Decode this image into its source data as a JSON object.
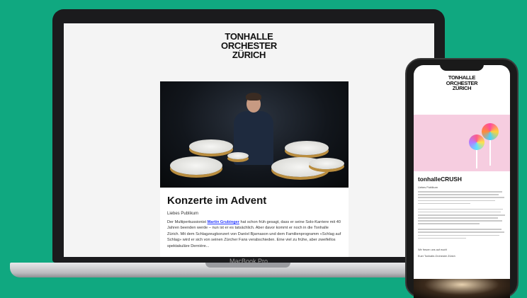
{
  "laptop": {
    "label": "MacBook Pro",
    "email": {
      "logo": [
        "TONHALLE",
        "ORCHESTER",
        "ZÜRICH"
      ],
      "title": "Konzerte im Advent",
      "greeting": "Liebes Publikum",
      "body_before": "Der Multiperkussionist ",
      "body_link": "Martin Grubinger",
      "body_after": " hat schon früh gesagt, dass er seine Solo-Karriere mit 40 Jahren beenden werde – nun ist er es tatsächlich. Aber davor kommt er noch in die Tonhalle Zürich. Mit dem Schlagzeugkonzert von Daníel Bjarnason und dem Familienprogramm «Schlag auf Schlag» wird er sich von seinen Zürcher Fans verabschieden. Eine viel zu frühe, aber zweifellos spektakuläre Dernière..."
    }
  },
  "phone": {
    "email": {
      "logo": [
        "TONHALLE",
        "ORCHESTER",
        "ZÜRICH"
      ],
      "title": "tonhalleCRUSH",
      "greeting": "Liebes Publikum",
      "sign_1": "Wir freuen uns auf euch!",
      "sign_2": "Euer Tonhalle-Orchester Zürich"
    }
  }
}
